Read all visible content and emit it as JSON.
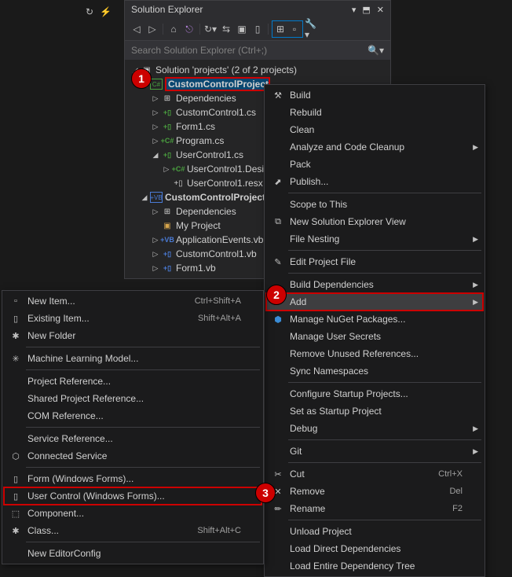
{
  "panel": {
    "title": "Solution Explorer",
    "searchPlaceholder": "Search Solution Explorer (Ctrl+;)"
  },
  "tree": {
    "solution": "Solution 'projects' (2 of 2 projects)",
    "project1": {
      "name": "CustomControlProject",
      "deps": "Dependencies",
      "files": [
        "CustomControl1.cs",
        "Form1.cs",
        "Program.cs",
        "UserControl1.cs"
      ],
      "sub1": "UserControl1.Desi",
      "sub2": "UserControl1.resx"
    },
    "project2": {
      "name": "CustomControlProjectVE",
      "deps": "Dependencies",
      "myproj": "My Project",
      "files": [
        "ApplicationEvents.vb",
        "CustomControl1.vb",
        "Form1.vb"
      ]
    }
  },
  "menu1": {
    "build": "Build",
    "rebuild": "Rebuild",
    "clean": "Clean",
    "analyze": "Analyze and Code Cleanup",
    "pack": "Pack",
    "publish": "Publish...",
    "scope": "Scope to This",
    "newview": "New Solution Explorer View",
    "nesting": "File Nesting",
    "editproj": "Edit Project File",
    "builddeps": "Build Dependencies",
    "add": "Add",
    "nuget": "Manage NuGet Packages...",
    "secrets": "Manage User Secrets",
    "unused": "Remove Unused References...",
    "sync": "Sync Namespaces",
    "startup": "Configure Startup Projects...",
    "setstartup": "Set as Startup Project",
    "debug": "Debug",
    "git": "Git",
    "cut": "Cut",
    "cutkey": "Ctrl+X",
    "remove": "Remove",
    "removekey": "Del",
    "rename": "Rename",
    "renamekey": "F2",
    "unload": "Unload Project",
    "loaddirect": "Load Direct Dependencies",
    "loadtree": "Load Entire Dependency Tree"
  },
  "menu2": {
    "newitem": "New Item...",
    "newitemkey": "Ctrl+Shift+A",
    "existing": "Existing Item...",
    "existingkey": "Shift+Alt+A",
    "newfolder": "New Folder",
    "ml": "Machine Learning Model...",
    "projref": "Project Reference...",
    "sharedref": "Shared Project Reference...",
    "comref": "COM Reference...",
    "svcref": "Service Reference...",
    "connsvc": "Connected Service",
    "form": "Form (Windows Forms)...",
    "usercontrol": "User Control (Windows Forms)...",
    "component": "Component...",
    "class": "Class...",
    "classkey": "Shift+Alt+C",
    "editorconfig": "New EditorConfig"
  }
}
